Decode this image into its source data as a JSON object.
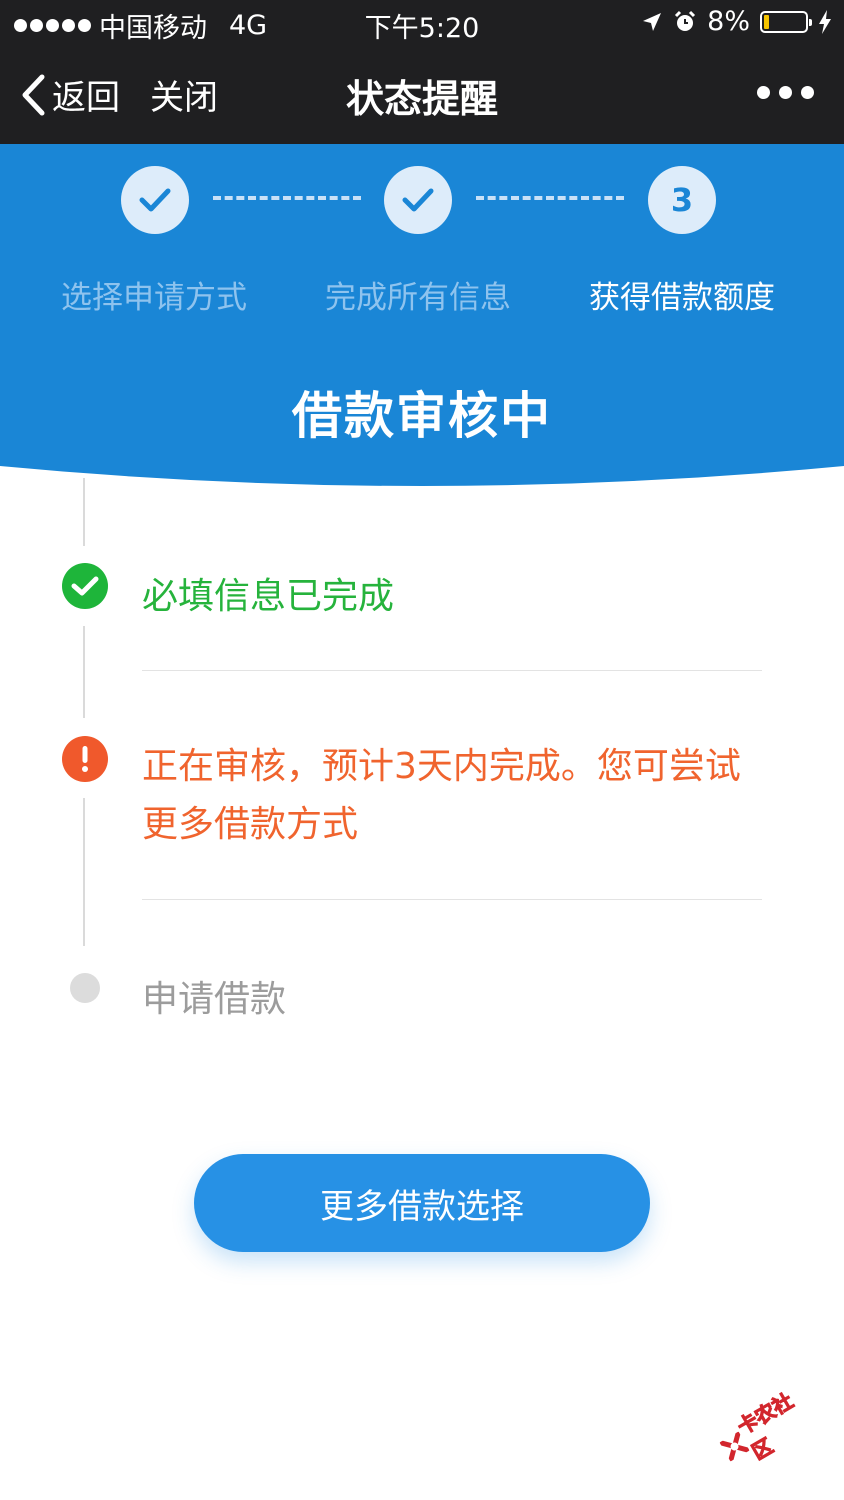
{
  "status_bar": {
    "carrier": "中国移动",
    "network": "4G",
    "time": "下午5:20",
    "battery": "8%",
    "battery_level": 0.08
  },
  "nav": {
    "back_label": "返回",
    "close_label": "关闭",
    "title": "状态提醒"
  },
  "steps": [
    {
      "number": "1",
      "label": "选择申请方式",
      "state": "done"
    },
    {
      "number": "2",
      "label": "完成所有信息",
      "state": "done"
    },
    {
      "number": "3",
      "label": "获得借款额度",
      "state": "current"
    }
  ],
  "header_title": "借款审核中",
  "timeline": [
    {
      "text": "必填信息已完成",
      "state": "done",
      "color": "#26b33c"
    },
    {
      "text": "正在审核，预计3天内完成。您可尝试更多借款方式",
      "state": "warning",
      "color": "#f0642e"
    },
    {
      "text": "申请借款",
      "state": "pending",
      "color": "#9c9c9c"
    }
  ],
  "button_label": "更多借款选择",
  "watermark_text": "卡农社区",
  "colors": {
    "nav_bg": "#1f1f21",
    "header_blue": "#1a86d6",
    "button_blue": "#2791e5",
    "success": "#1eb53a",
    "warning": "#f0592c"
  }
}
